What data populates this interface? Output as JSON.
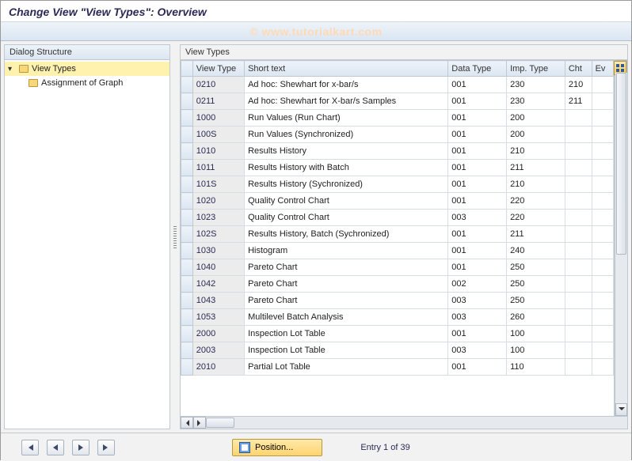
{
  "header": {
    "title": "Change View \"View Types\": Overview",
    "watermark": "© www.tutorialkart.com"
  },
  "tree": {
    "header": "Dialog Structure",
    "root_label": "View Types",
    "child_label": "Assignment of Graph"
  },
  "table": {
    "group_title": "View Types",
    "columns": {
      "view_type": "View Type",
      "short_text": "Short text",
      "data_type": "Data Type",
      "imp_type": "Imp. Type",
      "cht": "Cht",
      "ev": "Ev"
    },
    "rows": [
      {
        "vt": "0210",
        "st": "Ad hoc: Shewhart for x-bar/s",
        "dt": "001",
        "it": "230",
        "cht": "210"
      },
      {
        "vt": "0211",
        "st": "Ad hoc: Shewhart for X-bar/s Samples",
        "dt": "001",
        "it": "230",
        "cht": "211"
      },
      {
        "vt": "1000",
        "st": "Run Values (Run Chart)",
        "dt": "001",
        "it": "200",
        "cht": ""
      },
      {
        "vt": "100S",
        "st": "Run Values (Synchronized)",
        "dt": "001",
        "it": "200",
        "cht": ""
      },
      {
        "vt": "1010",
        "st": "Results History",
        "dt": "001",
        "it": "210",
        "cht": ""
      },
      {
        "vt": "1011",
        "st": "Results History with Batch",
        "dt": "001",
        "it": "211",
        "cht": ""
      },
      {
        "vt": "101S",
        "st": "Results History (Sychronized)",
        "dt": "001",
        "it": "210",
        "cht": ""
      },
      {
        "vt": "1020",
        "st": "Quality Control Chart",
        "dt": "001",
        "it": "220",
        "cht": ""
      },
      {
        "vt": "1023",
        "st": "Quality Control Chart",
        "dt": "003",
        "it": "220",
        "cht": ""
      },
      {
        "vt": "102S",
        "st": "Results History, Batch  (Sychronized)",
        "dt": "001",
        "it": "211",
        "cht": ""
      },
      {
        "vt": "1030",
        "st": "Histogram",
        "dt": "001",
        "it": "240",
        "cht": ""
      },
      {
        "vt": "1040",
        "st": "Pareto Chart",
        "dt": "001",
        "it": "250",
        "cht": ""
      },
      {
        "vt": "1042",
        "st": "Pareto Chart",
        "dt": "002",
        "it": "250",
        "cht": ""
      },
      {
        "vt": "1043",
        "st": "Pareto Chart",
        "dt": "003",
        "it": "250",
        "cht": ""
      },
      {
        "vt": "1053",
        "st": "Multilevel Batch Analysis",
        "dt": "003",
        "it": "260",
        "cht": ""
      },
      {
        "vt": "2000",
        "st": "Inspection Lot Table",
        "dt": "001",
        "it": "100",
        "cht": ""
      },
      {
        "vt": "2003",
        "st": "Inspection Lot Table",
        "dt": "003",
        "it": "100",
        "cht": ""
      },
      {
        "vt": "2010",
        "st": "Partial Lot Table",
        "dt": "001",
        "it": "110",
        "cht": ""
      }
    ]
  },
  "footer": {
    "position_label": "Position...",
    "entry_text": "Entry 1 of 39"
  }
}
